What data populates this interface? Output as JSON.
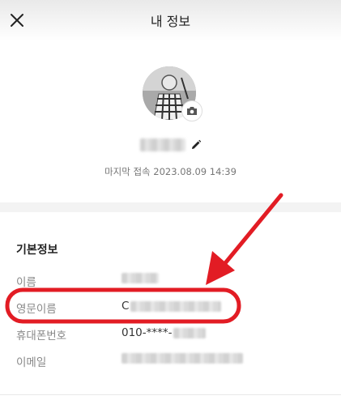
{
  "header": {
    "title": "내 정보",
    "close_icon": "close-icon"
  },
  "profile": {
    "last_login": "마지막 접속 2023.08.09 14:39",
    "edit_icon": "pencil-icon",
    "camera_icon": "camera-icon"
  },
  "basic_info": {
    "title": "기본정보",
    "rows": [
      {
        "label": "이름",
        "value": ""
      },
      {
        "label": "영문이름",
        "value": "C"
      },
      {
        "label": "휴대폰번호",
        "value": "010-****-"
      },
      {
        "label": "이메일",
        "value": ""
      }
    ]
  },
  "annotation": {
    "color": "#e21c24"
  }
}
